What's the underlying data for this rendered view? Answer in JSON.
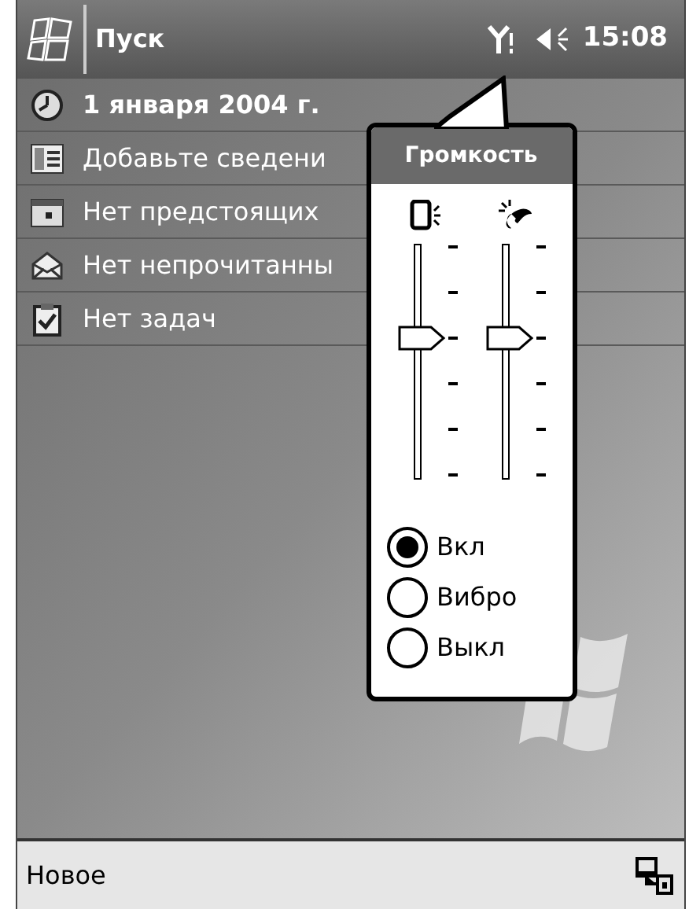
{
  "top_bar": {
    "title": "Пуск",
    "time": "15:08"
  },
  "today_items": [
    {
      "kind": "date",
      "text": "1 января 2004 г."
    },
    {
      "kind": "owner",
      "text": "Добавьте сведени"
    },
    {
      "kind": "calendar",
      "text": "Нет предстоящих"
    },
    {
      "kind": "mail",
      "text": "Нет непрочитанны"
    },
    {
      "kind": "tasks",
      "text": "Нет задач"
    }
  ],
  "volume_popup": {
    "title": "Громкость",
    "sliders": [
      {
        "kind": "device",
        "level": 0.6
      },
      {
        "kind": "ringer",
        "level": 0.6
      }
    ],
    "modes": [
      {
        "label": "Вкл",
        "selected": true
      },
      {
        "label": "Вибро",
        "selected": false
      },
      {
        "label": "Выкл",
        "selected": false
      }
    ]
  },
  "bottom_bar": {
    "softkey": "Новое"
  }
}
